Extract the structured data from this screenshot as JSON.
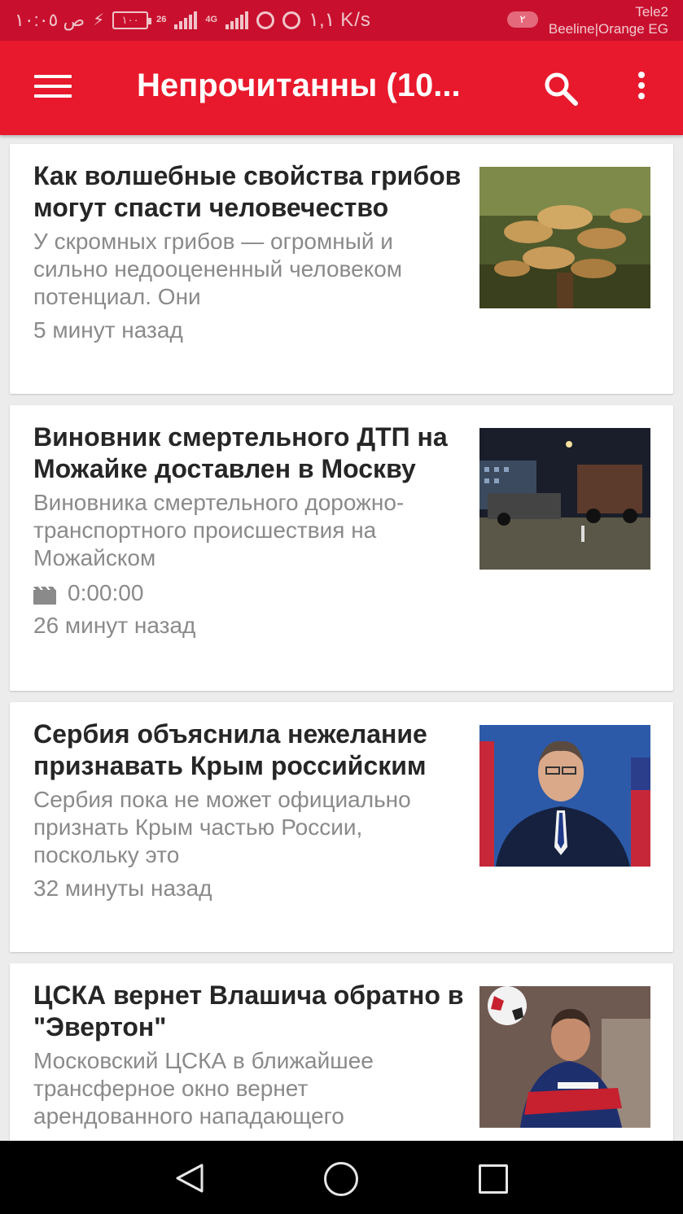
{
  "status_bar": {
    "time": "ص ١٠:٠٥",
    "battery": "١٠٠",
    "net_a": "26",
    "net_b": "4G",
    "speed": "١,١ K/s",
    "sim_badge": "٢",
    "carrier_1": "Tele2",
    "carrier_2": "Beeline|Orange EG"
  },
  "app_bar": {
    "title": "Непрочитанны (10...",
    "menu_icon": "hamburger-icon",
    "search_icon": "search-icon",
    "more_icon": "more-vertical-icon"
  },
  "articles": [
    {
      "headline": "Как волшебные свойства грибов могут спасти человечество",
      "summary": "У скромных грибов — огромный и сильно недооцененный человеком потенциал. Они",
      "time_ago": "5 минут назад",
      "thumbnail": "mushrooms"
    },
    {
      "headline": "Виновник смертельного ДТП на Можайке доставлен в Москву",
      "summary": "Виновника смертельного дорожно-транспортного происшествия на Можайском",
      "video_duration": "0:00:00",
      "time_ago": "26 минут назад",
      "thumbnail": "night-road"
    },
    {
      "headline": "Сербия объяснила нежелание признавать Крым российским",
      "summary": "Сербия пока не может официально признать Крым частью России, поскольку это",
      "time_ago": "32 минуты назад",
      "thumbnail": "politician"
    },
    {
      "headline": "ЦСКА вернет Влашича обратно в \"Эвертон\"",
      "summary": "Московский ЦСКА в ближайшее трансферное окно вернет арендованного нападающего",
      "time_ago": "",
      "thumbnail": "footballer"
    }
  ],
  "colors": {
    "status_bar": "#c8102e",
    "app_bar": "#e8192c",
    "headline": "#262626",
    "secondary_text": "#8a8a8a"
  }
}
